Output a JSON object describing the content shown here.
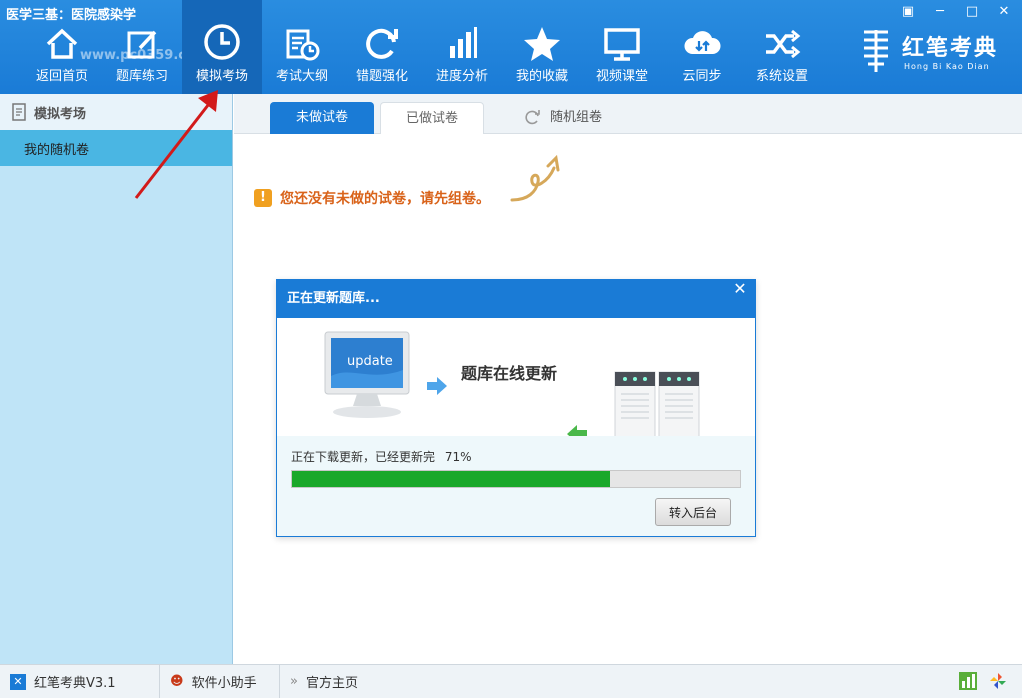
{
  "app": {
    "title": "医学三基：医院感染学",
    "watermark": "www.pc0359.cn",
    "window_controls": [
      "▣",
      "─",
      "□",
      "✕"
    ]
  },
  "nav": [
    {
      "label": "返回首页",
      "icon": "home-icon"
    },
    {
      "label": "题库练习",
      "icon": "edit-icon"
    },
    {
      "label": "模拟考场",
      "icon": "clock-icon",
      "active": true
    },
    {
      "label": "考试大纲",
      "icon": "calendar-clock-icon"
    },
    {
      "label": "错题强化",
      "icon": "refresh-icon"
    },
    {
      "label": "进度分析",
      "icon": "bar-chart-icon"
    },
    {
      "label": "我的收藏",
      "icon": "star-icon"
    },
    {
      "label": "视频课堂",
      "icon": "monitor-icon"
    },
    {
      "label": "云同步",
      "icon": "cloud-sync-icon"
    },
    {
      "label": "系统设置",
      "icon": "shuffle-icon"
    }
  ],
  "brand": {
    "name": "红笔考典",
    "pinyin": "Hong Bi Kao Dian"
  },
  "sidebar": {
    "heading": "模拟考场",
    "items": [
      {
        "label": "我的随机卷"
      }
    ]
  },
  "tabs": {
    "undone": "未做试卷",
    "done": "已做试卷",
    "random": "随机组卷"
  },
  "main": {
    "warning": "您还没有未做的试卷，请先组卷。"
  },
  "dialog": {
    "title": "正在更新题库...",
    "monitor_text": "update",
    "caption": "题库在线更新",
    "progress_label": "正在下载更新，已经更新完",
    "progress_percent_text": "71%",
    "progress_fraction": 0.71,
    "background_button": "转入后台"
  },
  "statusbar": {
    "version": "红笔考典V3.1",
    "helper": "软件小助手",
    "homepage": "官方主页"
  },
  "colors": {
    "primary": "#1a7bd6",
    "progress": "#1aa82a",
    "warning": "#d9631a",
    "sidebar": "#bfe4f7"
  }
}
